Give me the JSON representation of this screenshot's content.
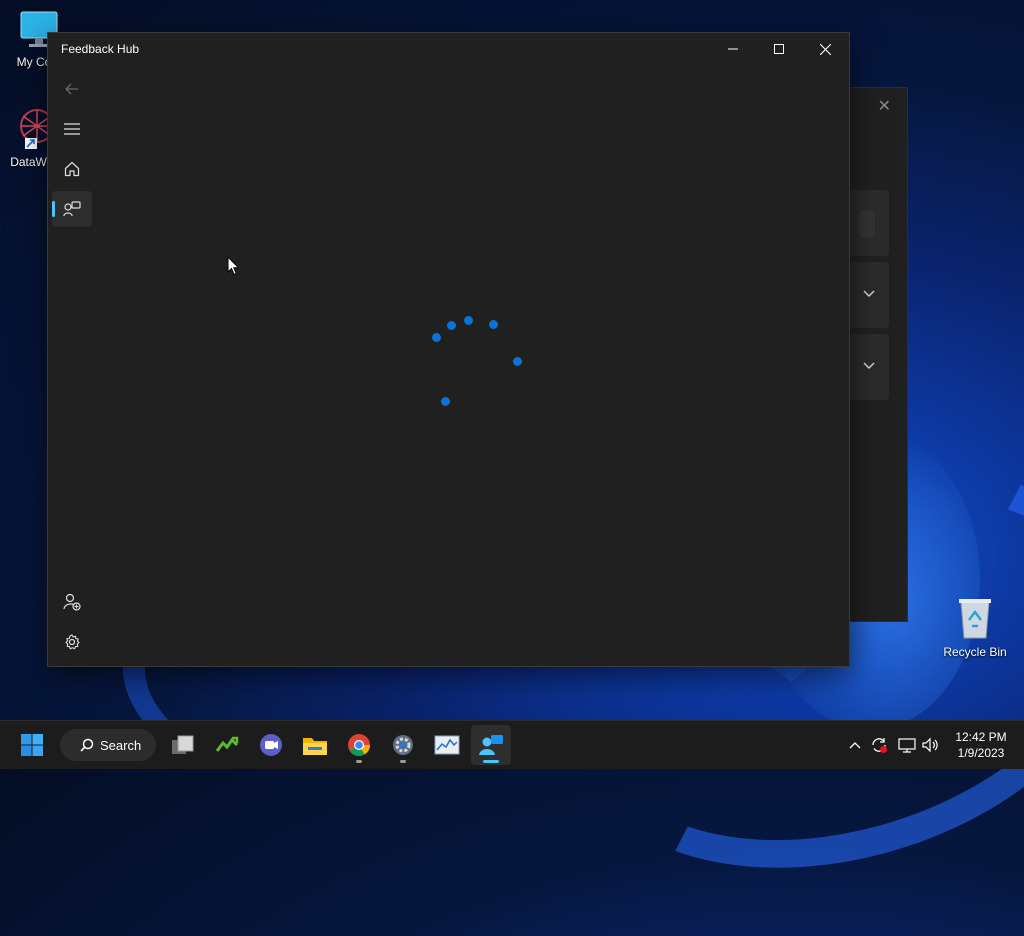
{
  "desktop": {
    "icons": [
      {
        "label": "My Com",
        "icon": "computer-icon"
      },
      {
        "label": "DataWag",
        "icon": "datawagon-icon"
      },
      {
        "label": "Recycle Bin",
        "icon": "recycle-bin-icon"
      }
    ]
  },
  "window": {
    "title": "Feedback Hub",
    "controls": [
      "minimize-icon",
      "maximize-icon",
      "close-icon"
    ],
    "nav": {
      "top": [
        "back-arrow-icon",
        "hamburger-menu-icon",
        "home-icon",
        "feedback-icon"
      ],
      "selected": "feedback-icon",
      "bottom": [
        "add-user-icon",
        "settings-gear-icon"
      ]
    },
    "content_state": "loading",
    "spinner_color": "#0a74d6"
  },
  "taskbar": {
    "search_label": "Search",
    "apps": [
      "start-icon",
      "task-view-icon",
      "nvidia-icon",
      "teams-chat-icon",
      "file-explorer-icon",
      "chrome-icon",
      "settings-icon",
      "resource-monitor-icon",
      "feedback-hub-icon"
    ],
    "active_app": "feedback-hub-icon",
    "tray": [
      "chevron-up-icon",
      "sync-icon",
      "network-icon",
      "volume-icon"
    ],
    "time": "12:42 PM",
    "date": "1/9/2023"
  },
  "colors": {
    "accent": "#4cc2ff",
    "window_bg": "#202020",
    "taskbar_bg": "#1c1c1c"
  }
}
